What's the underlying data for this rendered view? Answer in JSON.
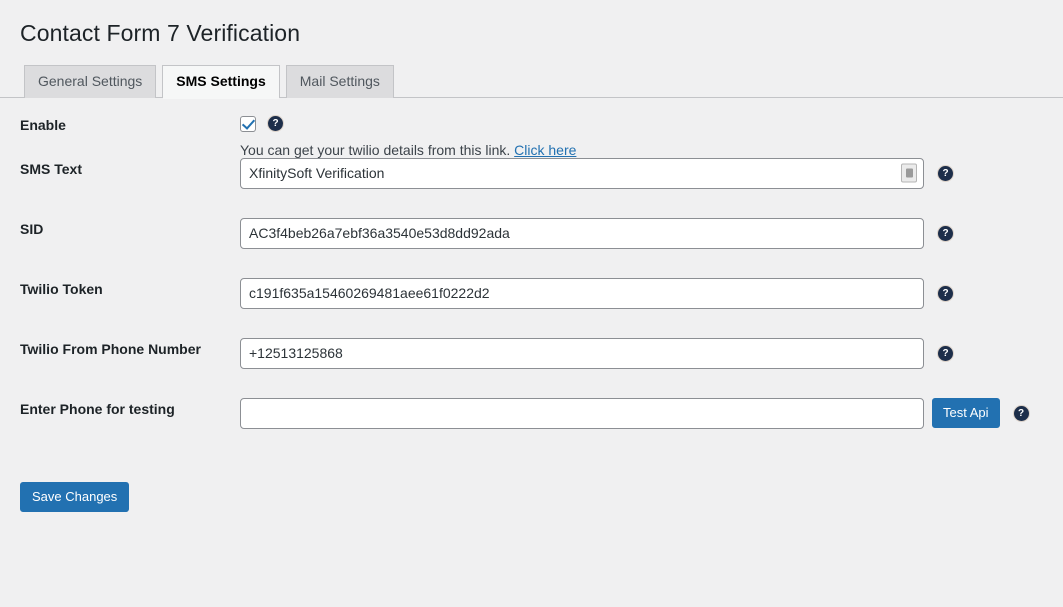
{
  "header": {
    "title": "Contact Form 7 Verification"
  },
  "tabs": [
    {
      "label": "General Settings",
      "active": false
    },
    {
      "label": "SMS Settings",
      "active": true
    },
    {
      "label": "Mail Settings",
      "active": false
    }
  ],
  "form": {
    "enable": {
      "label": "Enable",
      "checked": true,
      "hint_text": "You can get your twilio details from this link.",
      "hint_link": "Click here",
      "help_icon": "question-mark-icon"
    },
    "sms_text": {
      "label": "SMS Text",
      "value": "XfinitySoft Verification",
      "placeholder": "",
      "inline_icon": "autofill-contact-icon",
      "help_icon": "question-mark-icon"
    },
    "sid": {
      "label": "SID",
      "value": "AC3f4beb26a7ebf36a3540e53d8dd92ada",
      "placeholder": "",
      "help_icon": "question-mark-icon"
    },
    "twilio_token": {
      "label": "Twilio Token",
      "value": "c191f635a15460269481aee61f0222d2",
      "placeholder": "",
      "help_icon": "question-mark-icon"
    },
    "twilio_from_phone": {
      "label": "Twilio From Phone Number",
      "value": "+12513125868",
      "placeholder": "",
      "help_icon": "question-mark-icon"
    },
    "test_phone": {
      "label": "Enter Phone for testing",
      "value": "",
      "placeholder": "",
      "button_label": "Test Api",
      "help_icon": "question-mark-icon"
    },
    "save_label": "Save Changes"
  },
  "colors": {
    "accent": "#2271b1",
    "page_background": "#f0f0f1",
    "tab_inactive": "#dcdcde",
    "tab_active": "#f6f7f7",
    "link": "#2271b1",
    "help_icon": "#1d2e4a"
  },
  "help_glyph": "?"
}
